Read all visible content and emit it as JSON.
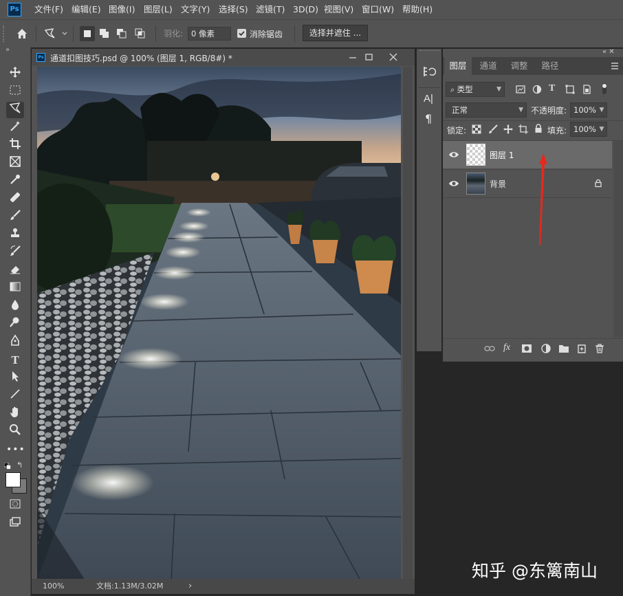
{
  "app": {
    "logo_text": "Ps",
    "menus": [
      "文件(F)",
      "编辑(E)",
      "图像(I)",
      "图层(L)",
      "文字(Y)",
      "选择(S)",
      "滤镜(T)",
      "3D(D)",
      "视图(V)",
      "窗口(W)",
      "帮助(H)"
    ]
  },
  "options": {
    "feather_label": "羽化:",
    "feather_value": "0 像素",
    "antialias_label": "消除锯齿",
    "select_mask_label": "选择并遮住 ..."
  },
  "toolbar": {
    "collapse_glyph": "»",
    "tools": [
      "move-tool",
      "marquee-tool",
      "lasso-tool",
      "magic-wand-tool",
      "crop-tool",
      "frame-tool",
      "eyedropper-tool",
      "healing-tool",
      "brush-tool",
      "stamp-tool",
      "history-brush-tool",
      "eraser-tool",
      "gradient-tool",
      "blur-tool",
      "dodge-tool",
      "pen-tool",
      "type-tool",
      "path-select-tool",
      "line-tool",
      "hand-tool",
      "zoom-tool",
      "more-tools"
    ]
  },
  "document": {
    "tab_title": "通道扣图技巧.psd @ 100% (图层 1, RGB/8#) *",
    "zoom": "100%",
    "doc_info": "文档:1.13M/3.02M",
    "status_arrow": "›"
  },
  "layers_panel": {
    "tabs": [
      "图层",
      "通道",
      "调整",
      "路径"
    ],
    "filter_label": "类型",
    "blend_mode": "正常",
    "opacity_label": "不透明度:",
    "opacity_value": "100%",
    "lock_label": "锁定:",
    "fill_label": "填充:",
    "fill_value": "100%",
    "layers": [
      {
        "name": "图层 1",
        "selected": true,
        "locked": false
      },
      {
        "name": "背景",
        "selected": false,
        "locked": true
      }
    ]
  },
  "watermark": "知乎 @东篱南山",
  "colors": {
    "accent": "#31a8ff",
    "panel": "#535353",
    "dark": "#262626",
    "arrow": "#e8281d"
  }
}
